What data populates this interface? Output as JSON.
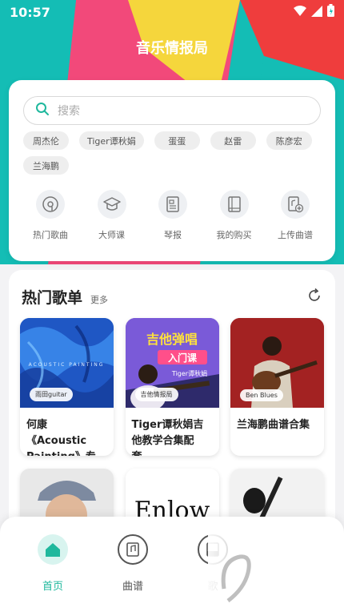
{
  "status": {
    "time": "10:57"
  },
  "app": {
    "title": "音乐情报局"
  },
  "search": {
    "placeholder": "搜索"
  },
  "tags": [
    "周杰伦",
    "Tiger谭秋娟",
    "蛋蛋",
    "赵雷",
    "陈彦宏",
    "兰海鹏"
  ],
  "quick_actions": [
    {
      "label": "热门歌曲",
      "icon": "music-disc-icon"
    },
    {
      "label": "大师课",
      "icon": "graduation-cap-icon"
    },
    {
      "label": "琴报",
      "icon": "newspaper-icon"
    },
    {
      "label": "我的购买",
      "icon": "book-icon"
    },
    {
      "label": "上传曲谱",
      "icon": "upload-score-icon"
    }
  ],
  "hot_playlist": {
    "title": "热门歌单",
    "more": "更多",
    "albums": [
      {
        "badge": "雨田guitar",
        "title": "何康《Acoustic Painting》专辑…",
        "cover_text": "ACOUSTIC PAINTING"
      },
      {
        "badge": "吉他情报局",
        "title": "Tiger谭秋娟吉他教学合集配套…",
        "cover_text_1": "吉他弹唱",
        "cover_text_2": "入门课",
        "cover_text_3": "Tiger谭秋娟"
      },
      {
        "badge": "Ben Blues",
        "title": "兰海鹏曲谱合集"
      }
    ],
    "albums_row2": [
      {
        "name": "avatar-cover"
      },
      {
        "cover_text": "Enlow"
      },
      {
        "name": "guitarist-cover"
      }
    ]
  },
  "bottom_nav": [
    {
      "label": "首页",
      "active": true
    },
    {
      "label": "曲谱",
      "active": false
    },
    {
      "label": "歌",
      "active": false
    }
  ],
  "colors": {
    "accent": "#1fb89d",
    "teal": "#14bdb5",
    "pink": "#f2497a",
    "red": "#ef3d3d",
    "yellow": "#f5d63c"
  }
}
